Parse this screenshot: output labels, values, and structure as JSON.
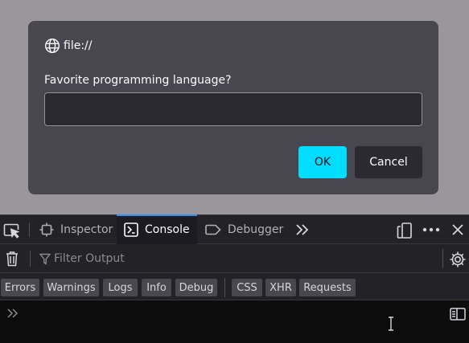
{
  "dialog": {
    "origin_text": "file://",
    "message": "Favorite programming language?",
    "input_value": "",
    "ok_label": "OK",
    "cancel_label": "Cancel"
  },
  "devtools": {
    "tabs": [
      {
        "label": "Inspector",
        "icon": "inspector-icon",
        "selected": false
      },
      {
        "label": "Console",
        "icon": "console-icon",
        "selected": true
      },
      {
        "label": "Debugger",
        "icon": "debugger-icon",
        "selected": false
      }
    ],
    "filter_placeholder": "Filter Output",
    "filter_value": "",
    "log_levels": [
      "Errors",
      "Warnings",
      "Logs",
      "Info",
      "Debug"
    ],
    "request_types": [
      "CSS",
      "XHR",
      "Requests"
    ],
    "console_input": ""
  },
  "colors": {
    "accent": "#00ddff",
    "dialog_bg": "#48464f",
    "selected_tab_indicator": "#2f8cf7"
  }
}
